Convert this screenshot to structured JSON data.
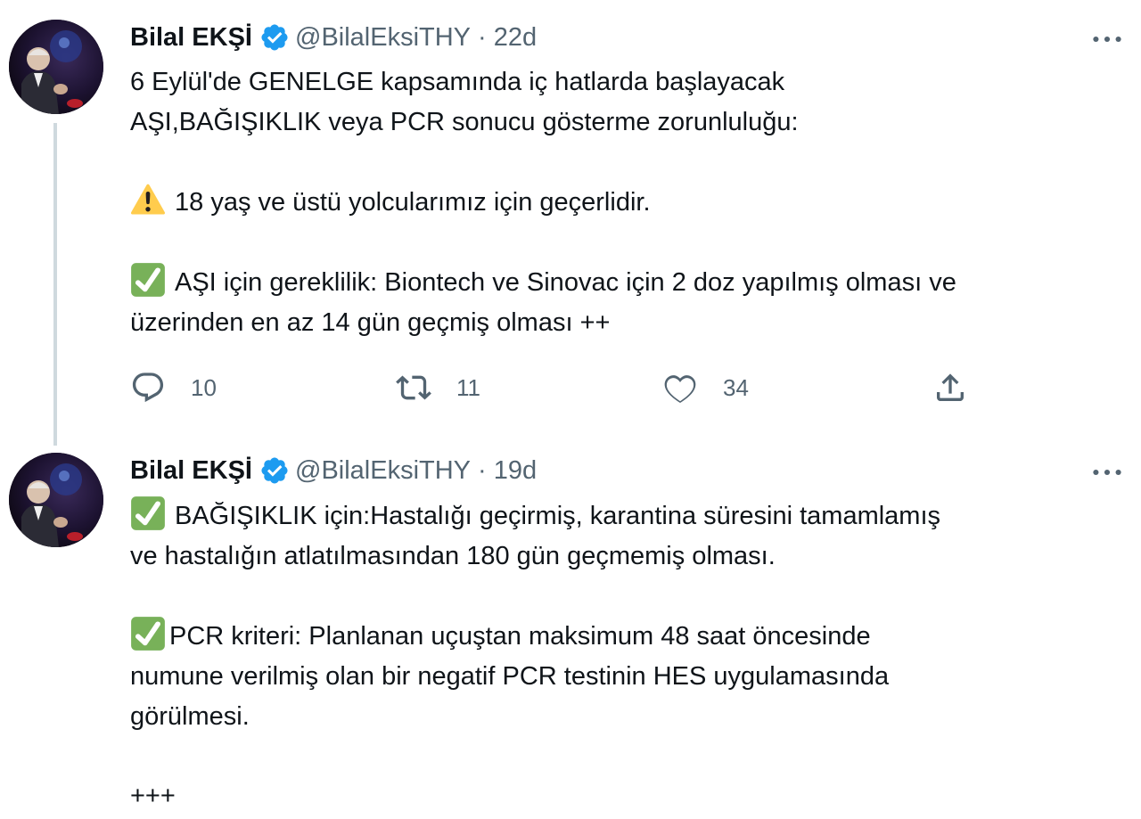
{
  "colors": {
    "verified": "#1d9bf0",
    "secondary_text": "#536471",
    "thread_line": "#cfd9de",
    "check_green": "#78b159",
    "warning_yellow": "#ffcc4d"
  },
  "tweets": [
    {
      "name": "Bilal EKŞİ",
      "handle": "@BilalEksiTHY",
      "separator": "·",
      "time": "22d",
      "verified_icon": "verified-badge-icon",
      "more_icon": "more-dots-icon",
      "lines": [
        "6 Eylül'de GENELGE kapsamında iç hatlarda başlayacak",
        "AŞI,BAĞIŞIKLIK veya PCR sonucu gösterme zorunluluğu:",
        "18 yaş ve üstü yolcularımız için geçerlidir.",
        "AŞI için gereklilik: Biontech ve Sinovac için 2 doz yapılmış olması ve",
        "üzerinden en az 14 gün geçmiş olması ++"
      ],
      "actions": {
        "reply_count": "10",
        "retweet_count": "11",
        "like_count": "34"
      }
    },
    {
      "name": "Bilal EKŞİ",
      "handle": "@BilalEksiTHY",
      "separator": "·",
      "time": "19d",
      "verified_icon": "verified-badge-icon",
      "more_icon": "more-dots-icon",
      "lines": [
        "BAĞIŞIKLIK için:Hastalığı geçirmiş, karantina süresini tamamlamış",
        "ve hastalığın atlatılmasından 180 gün geçmemiş olması.",
        "PCR kriteri: Planlanan uçuştan maksimum 48 saat öncesinde",
        "numune verilmiş olan bir negatif PCR testinin HES uygulamasında",
        "görülmesi.",
        "+++"
      ]
    }
  ]
}
